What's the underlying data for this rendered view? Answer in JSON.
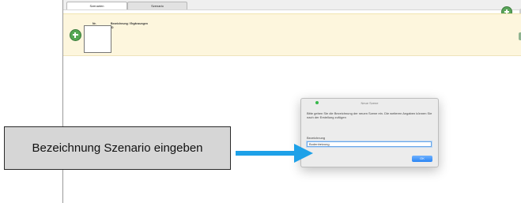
{
  "tabs": [
    {
      "label": "Szenarien"
    },
    {
      "label": "Szenario"
    }
  ],
  "table": {
    "col_nr": "Nr.",
    "col_bezeichnung": "Bezeichnung / Ergänzungen",
    "col_sub": "ID"
  },
  "dialog": {
    "title": "Neue Szene",
    "message": "Bitte geben Sie die Bezeichnung der neuen Szene ein. Die weiteren Angaben können Sie nach der Erstellung zufügen",
    "field_label": "Bezeichnung",
    "field_value": "Bodenheizung",
    "ok_label": "OK"
  },
  "callout": {
    "text": "Bezeichnung Szenario eingeben"
  },
  "colors": {
    "header_strip": "#fdf6dd",
    "accent_green": "#54a754",
    "arrow": "#1ea1e8"
  }
}
